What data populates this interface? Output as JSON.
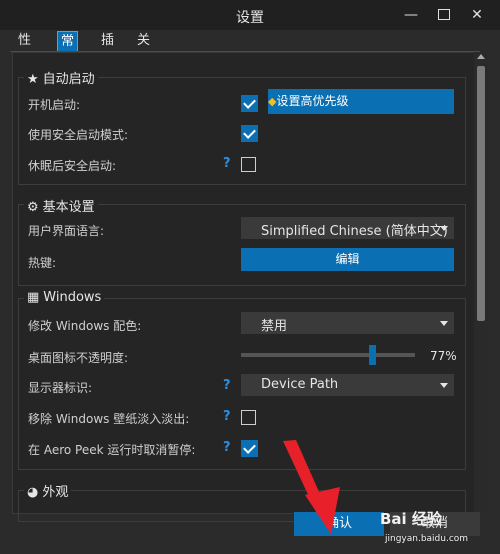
{
  "window": {
    "title": "设置",
    "minimize_glyph": "—",
    "close_glyph": "✕"
  },
  "tabs": [
    "性能",
    "常规",
    "插件",
    "关于"
  ],
  "autostart": {
    "title": "自动启动",
    "rows": [
      {
        "label": "开机启动:",
        "checked": true
      },
      {
        "label": "使用安全启动模式:",
        "checked": true
      },
      {
        "label": "休眠后安全启动:",
        "checked": false,
        "help": "?"
      }
    ],
    "priority_button": "设置高优先级"
  },
  "basic": {
    "title": "基本设置",
    "language_label": "用户界面语言:",
    "language_value": "Simplified Chinese (简体中文)",
    "hotkey_label": "热键:",
    "hotkey_button": "编辑"
  },
  "windows": {
    "title": "Windows",
    "color_label": "修改 Windows 配色:",
    "color_value": "禁用",
    "opacity_label": "桌面图标不透明度:",
    "opacity_value": 0.77,
    "opacity_text": "77%",
    "monitor_label": "显示器标识:",
    "monitor_value": "Device Path",
    "wallpaper_label": "移除 Windows 壁纸淡入淡出:",
    "wallpaper_checked": false,
    "aero_label": "在 Aero Peek 运行时取消暂停:",
    "aero_checked": true,
    "help": "?"
  },
  "appearance": {
    "title": "外观"
  },
  "footer": {
    "ok": "确认",
    "cancel": "取消"
  },
  "watermark": {
    "brand": "Bai 经验",
    "url": "jingyan.baidu.com"
  },
  "colors": {
    "accent": "#0b6fb3",
    "background": "#2b2b2b",
    "annotation_arrow": "#e8202a"
  },
  "icons": {
    "autostart": "star-icon",
    "basic": "gear-icon",
    "windows": "windows-logo-icon",
    "appearance": "palette-icon"
  }
}
